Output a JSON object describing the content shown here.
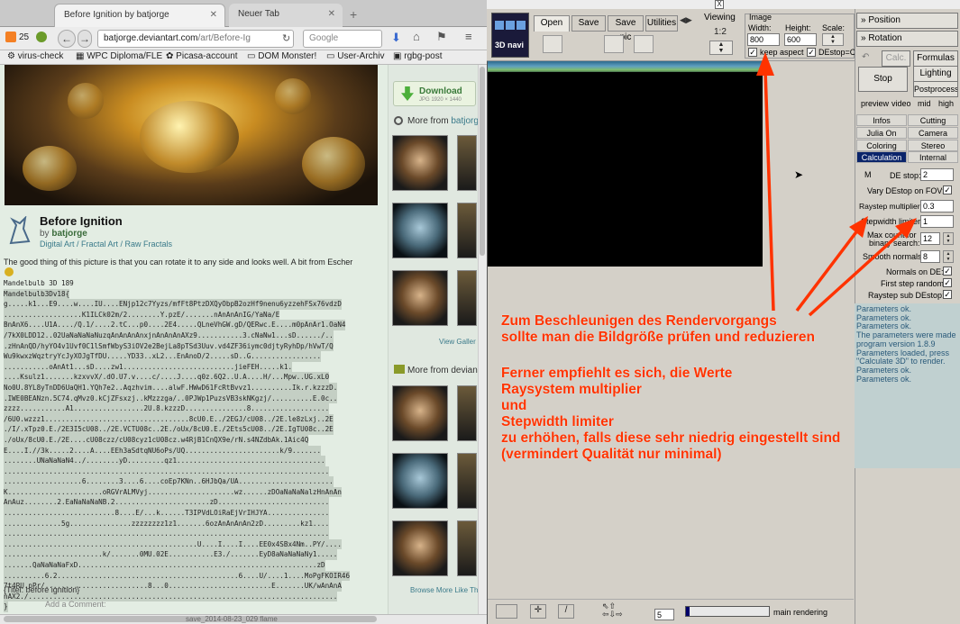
{
  "browser": {
    "tabs": [
      {
        "label": "Before Ignition by batjorge"
      },
      {
        "label": "Neuer Tab"
      }
    ],
    "nav": {
      "counter": "25",
      "url_host": "batjorge.deviantart.com",
      "url_path": "/art/Before-Ig",
      "search_engine": "Google"
    },
    "bookmarks": [
      "virus-check",
      "WPC Diploma/FLE",
      "Picasa-account",
      "DOM Monster!",
      "User-Archiv",
      "rgbg-post"
    ],
    "art": {
      "title": "Before Ignition",
      "by_prefix": "by",
      "author": "batjorge",
      "categories": "Digital Art / Fractal Art / Raw Fractals",
      "description": "The good thing of this picture is that you can rotate it to any side and looks well. A bit from Escher",
      "code_lines": [
        "Mandelbulb 3D 189",
        "Mandelbulb3Dv18{",
        "g.....k1...E9....w....IU....ENjp12c7Yyzs/mfFt8PtzDXQyObpB2ozHf9nenu6yzzehFSx76vdzD",
        "...................K1ILCk02m/2........Y.pzE/.......nAnAnAnIG/YaNa/E",
        "BnAnX6....U1A..../Q.1/....2.tC...p0....2E4.....QLneVhGW.gD/QERwc.E....m0pAnAr1.OaN4",
        "/7kX0LDD12..02UaNaNaNaNuzqAnAnAnAnxjnAnAnAnAXz9...........3.cNaNw1...sD....../..",
        ".zHnAnQD/hyYO4v1Uvf0C1lSmfWbyS3iOV2e2BejLa8pTSd3Uuv.vd4ZF36iymc0djtyRyhDp/hVwT/Q",
        "Wu9kwxzWqztryYcJyXOJgTfDU.....YD33..xL2...EnAnoD/2.....sD..G.................",
        "...........oAnAt1...sD....zw1...........................jieFEH.....k1.",
        "....Ksulz1.......kzxvvX/.dO.U7.v....c/....J....q0z.6Q2..U.A....H/...Mpw..UG.xL0",
        "No0U.8YL8yTnDD6UaQH1.YQh7e2..Aqzhvim....alwF.HWwD61FcRtBvvz1..........Ik.r.kzzzD.",
        ".IWE0BEANzn.5C74.qMvz0.kCjZFsxzj..kMzzzga/..0PJWp1PuzsVB3skNKgzj/..........E.0c..",
        "zzzz...........A1.................2U.8.kzzzD...............8...................",
        "/6U0.wzzz1...................................8cU0.E../2EGJ/cU08../2E.le8zLxj..2E",
        "./I/.xTpz0.E./2E3I5cU08../2E.VCTU08c..2E./oUx/8cU0.E./2Ets5cU08../2E.IgTU08c..2E",
        "./oUx/8cU0.E./2E....cU08czz/cU08cyz1cU08cz.w4RjB1CnQX9e/rN.s4NZdbAk.1Aic4Q",
        "E....I.//3k.....2....A....EEh3aSdtqNU6oPs/UQ.......................k/9.......",
        "........UNaNaNaN4../........yD.........qz1....................................",
        "...............................................................................",
        "...................6........3....6....coEp7KNn..6HJbQa/UA.......................",
        "K.......................oRGVrALMVyj.....................wz......zDOaNaNaNalzHnAnAn",
        "AnAuz........2.EaNaNaNaNB.2.......................zD...........................",
        "...........................8....E/...k......T3IPVdLOiRaEjVrIHJYA...............",
        "..............5g...............zzzzzzzz1z1.......6ozAnAnAnAn2zD.........kz1....",
        "...............................................................................",
        "...............................................U....I....I....EE0x4SBx4Nm..PY/....",
        "........................k/.......0MU.02E...........E3./.......EyD8aNaNaNaNy1.....",
        ".......QaNaNaNaFxD..........................................................zD",
        "..........6.2............................................6....U/....1....MoPgFKOIR46",
        "7t4RU.pPr/.........................8...0.........................E.......UK/wAnAnA",
        "nAX2./...........................................................................",
        "}"
      ],
      "title_line": "{Titel: before ignition}",
      "add_comment": "Add a Comment:"
    },
    "sidebar": {
      "download_label": "Download",
      "download_sub": "JPG 1920 × 1440",
      "more_from_prefix": "More from",
      "more_from_author": "batjorge",
      "view_gallery": "View Galler",
      "more_from_deviant": "More from devian",
      "browse_more": "Browse More Like Th"
    },
    "bottom_text": "save_2014-08-23_029 flame"
  },
  "mb3d": {
    "window_close": "X",
    "navi_label": "3D navi",
    "tabs": [
      "Open",
      "Save",
      "Save pic",
      "Utilities"
    ],
    "viewing_label": "Viewing",
    "viewing_scale": "1:2",
    "image": {
      "label": "Image",
      "width_label": "Width:",
      "width_value": "800",
      "height_label": "Height:",
      "height_value": "600",
      "scale_label": "Scale:",
      "keep_aspect_label": "keep aspect",
      "keep_aspect_checked": true,
      "destop_label": "DEstop=C",
      "destop_checked": true
    },
    "status_frame": "5",
    "status_text": "main rendering",
    "progress_fraction": 0.04
  },
  "panel": {
    "position": "» Position",
    "rotation": "» Rotation",
    "calc": "Calc.",
    "formulas": "Formulas",
    "lighting": "Lighting",
    "stop": "Stop",
    "postprocess": "Postprocess",
    "preview_options": [
      "preview",
      "video",
      "mid",
      "high"
    ],
    "tabs": [
      [
        "Infos",
        "Cutting"
      ],
      [
        "Julia On",
        "Camera"
      ],
      [
        "Coloring",
        "Stereo"
      ],
      [
        "Calculation",
        "Internal"
      ]
    ],
    "m_label": "M",
    "de_stop_label": "DE stop:",
    "de_stop_value": "2",
    "vary_destop_label": "Vary DEstop on FOV:",
    "raystep_label": "Raystep multiplier",
    "raystep_value": "0.3",
    "stepwidth_label": "Stepwidth limiter:",
    "stepwidth_value": "1",
    "bin_label_1": "Max count for",
    "bin_label_2": "binary search:",
    "bin_value": "12",
    "smooth_label": "Smooth normals:",
    "smooth_value": "8",
    "normals_de_label": "Normals on DE:",
    "first_step_label": "First step random:",
    "raystep_sub_label": "Raystep sub DEstop:",
    "log": [
      "Parameters ok.",
      "Parameters ok.",
      "Parameters ok.",
      "The parameters were made",
      "program version 1.8.9",
      "Parameters loaded, press",
      "\"Calculate 3D\" to render.",
      "Parameters ok.",
      "Parameters ok."
    ]
  },
  "annotation": {
    "line1": "Zum Beschleunigen des Rendervorgangs",
    "line2": "sollte man die Bildgröße prüfen und reduzieren",
    "line3": "Ferner empfiehlt es sich, die Werte",
    "line4": "Raysystem multiplier",
    "line5": "und",
    "line6": "Stepwidth limiter",
    "line7": "zu erhöhen, falls diese sehr niedrig eingestellt sind",
    "line8": "(vermindert Qualität nur minimal)",
    "color": "#ff3300"
  }
}
